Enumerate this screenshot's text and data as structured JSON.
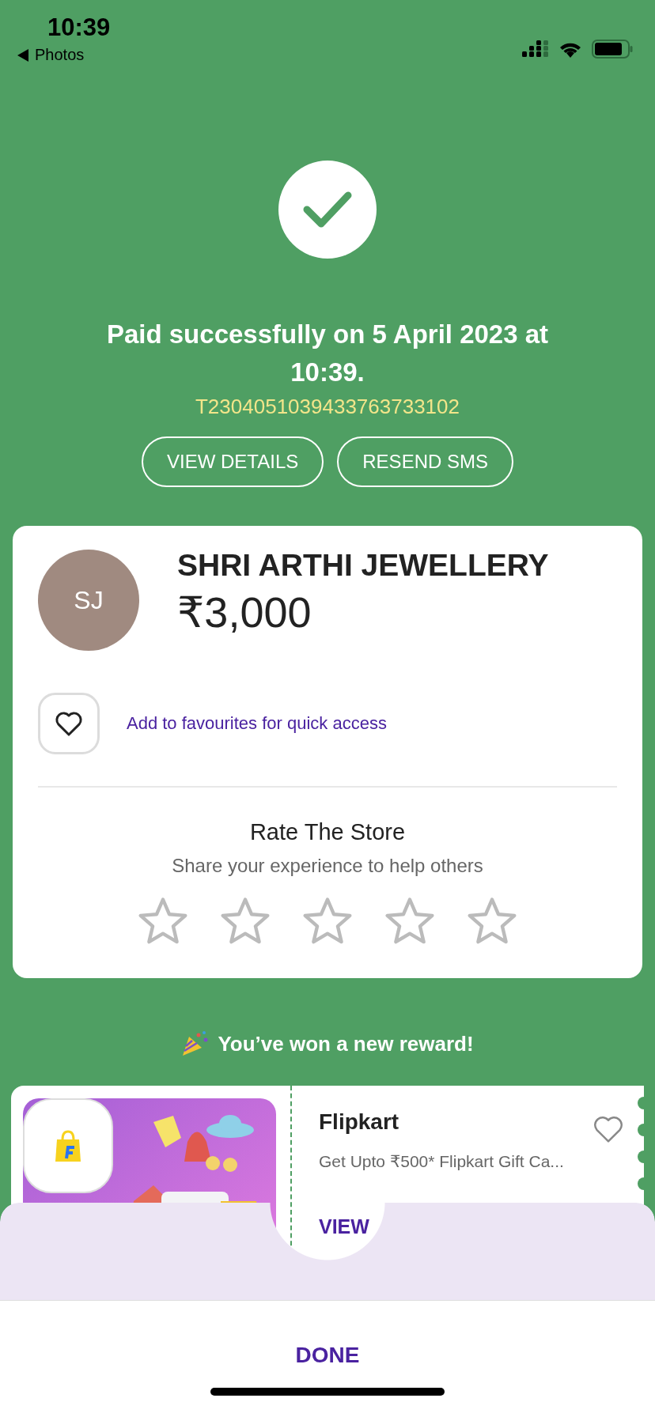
{
  "status_bar": {
    "time": "10:39",
    "back_label": "Photos"
  },
  "payment": {
    "title": "Paid successfully on 5 April 2023 at 10:39.",
    "transaction_id": "T2304051039433763733102",
    "actions": [
      "VIEW DETAILS",
      "RESEND SMS"
    ]
  },
  "merchant": {
    "initials": "SJ",
    "name": "SHRI ARTHI JEWELLERY",
    "amount": "₹3,000",
    "favourite_hint": "Add to favourites for quick access"
  },
  "rating": {
    "title": "Rate The Store",
    "subtitle": "Share your experience to help others",
    "stars": 0
  },
  "reward": {
    "heading": "You’ve won a new reward!",
    "brand": "Flipkart",
    "description": "Get Upto ₹500* Flipkart Gift Ca...",
    "action": "VIEW"
  },
  "footer": {
    "button": "DONE"
  }
}
